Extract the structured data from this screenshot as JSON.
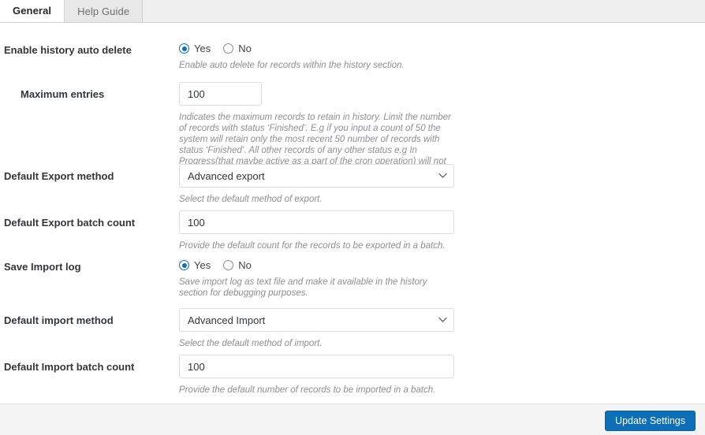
{
  "tabs": [
    {
      "id": "general",
      "label": "General",
      "active": true
    },
    {
      "id": "help-guide",
      "label": "Help Guide",
      "active": false
    }
  ],
  "settings": {
    "history_auto_delete": {
      "label": "Enable history auto delete",
      "yes_label": "Yes",
      "no_label": "No",
      "value": "Yes",
      "description": "Enable auto delete for records within the history section."
    },
    "maximum_entries": {
      "label": "Maximum entries",
      "value": "100",
      "description": "Indicates the maximum records to retain in history. Limit the number of records with status ‘Finished’. E.g if you input a count of 50 the system will retain only the most recent 50 number of records with status ‘Finished’. All other records of any other status e.g In Progress(that maybe active as a part of the cron operation) will not be impacted by this count."
    },
    "default_export_method": {
      "label": "Default Export method",
      "value": "Advanced export",
      "options": [
        "Advanced export"
      ],
      "description": "Select the default method of export."
    },
    "default_export_batch_count": {
      "label": "Default Export batch count",
      "value": "100",
      "description": "Provide the default count for the records to be exported in a batch."
    },
    "save_import_log": {
      "label": "Save Import log",
      "yes_label": "Yes",
      "no_label": "No",
      "value": "Yes",
      "description": "Save import log as text file and make it available in the history section for debugging purposes."
    },
    "default_import_method": {
      "label": "Default import method",
      "value": "Advanced Import",
      "options": [
        "Advanced Import"
      ],
      "description": "Select the default method of import."
    },
    "default_import_batch_count": {
      "label": "Default Import batch count",
      "value": "100",
      "description": "Provide the default number of records to be imported in a batch."
    }
  },
  "footer": {
    "update_label": "Update Settings"
  },
  "colors": {
    "accent": "#0d6fb8",
    "tabbar_bg": "#efefef",
    "footer_bg": "#f4f4f4",
    "description_text": "#8b8f94"
  }
}
